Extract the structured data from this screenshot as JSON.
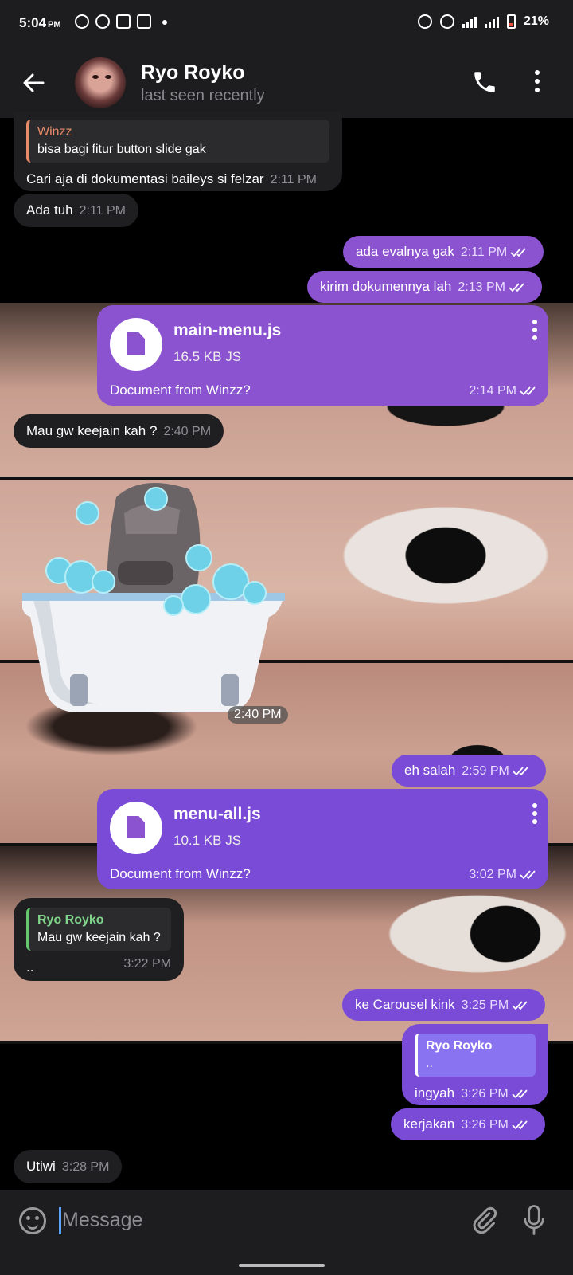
{
  "status_bar": {
    "time": "5:04",
    "ampm": "PM",
    "battery": "21%"
  },
  "header": {
    "name": "Ryo Royko",
    "status": "last seen recently"
  },
  "messages": {
    "m1": {
      "reply_name": "Winzz",
      "reply_text": "bisa bagi fitur button slide gak",
      "text": "Cari aja di dokumentasi baileys si felzar",
      "time": "2:11 PM"
    },
    "m2": {
      "text": "Ada tuh",
      "time": "2:11 PM"
    },
    "m3": {
      "text": "ada evalnya gak",
      "time": "2:11 PM"
    },
    "m4": {
      "text": "kirim dokumennya lah",
      "time": "2:13 PM"
    },
    "doc1": {
      "name": "main-menu.js",
      "size": "16.5 KB JS",
      "caption": "Document from Winzz?",
      "time": "2:14 PM"
    },
    "m5": {
      "text": "Mau gw keejain kah ?",
      "time": "2:40 PM"
    },
    "sticker": {
      "time": "2:40 PM"
    },
    "m6": {
      "text": "eh salah",
      "time": "2:59 PM"
    },
    "doc2": {
      "name": "menu-all.js",
      "size": "10.1 KB JS",
      "caption": "Document from Winzz?",
      "time": "3:02 PM"
    },
    "m7": {
      "reply_name": "Ryo Royko",
      "reply_text": "Mau gw keejain kah ?",
      "text": "..",
      "time": "3:22 PM"
    },
    "m8": {
      "text": "ke Carousel kink",
      "time": "3:25 PM"
    },
    "m9": {
      "reply_name": "Ryo Royko",
      "reply_text": "..",
      "text": "ingyah",
      "time": "3:26 PM"
    },
    "m10": {
      "text": "kerjakan",
      "time": "3:26 PM"
    },
    "m11": {
      "text": "Utiwi",
      "time": "3:28 PM"
    }
  },
  "composer": {
    "placeholder": "Message"
  },
  "colors": {
    "outgoing": "#7a4bd6",
    "incoming": "#1f1f22",
    "header": "#1d1d1f"
  }
}
